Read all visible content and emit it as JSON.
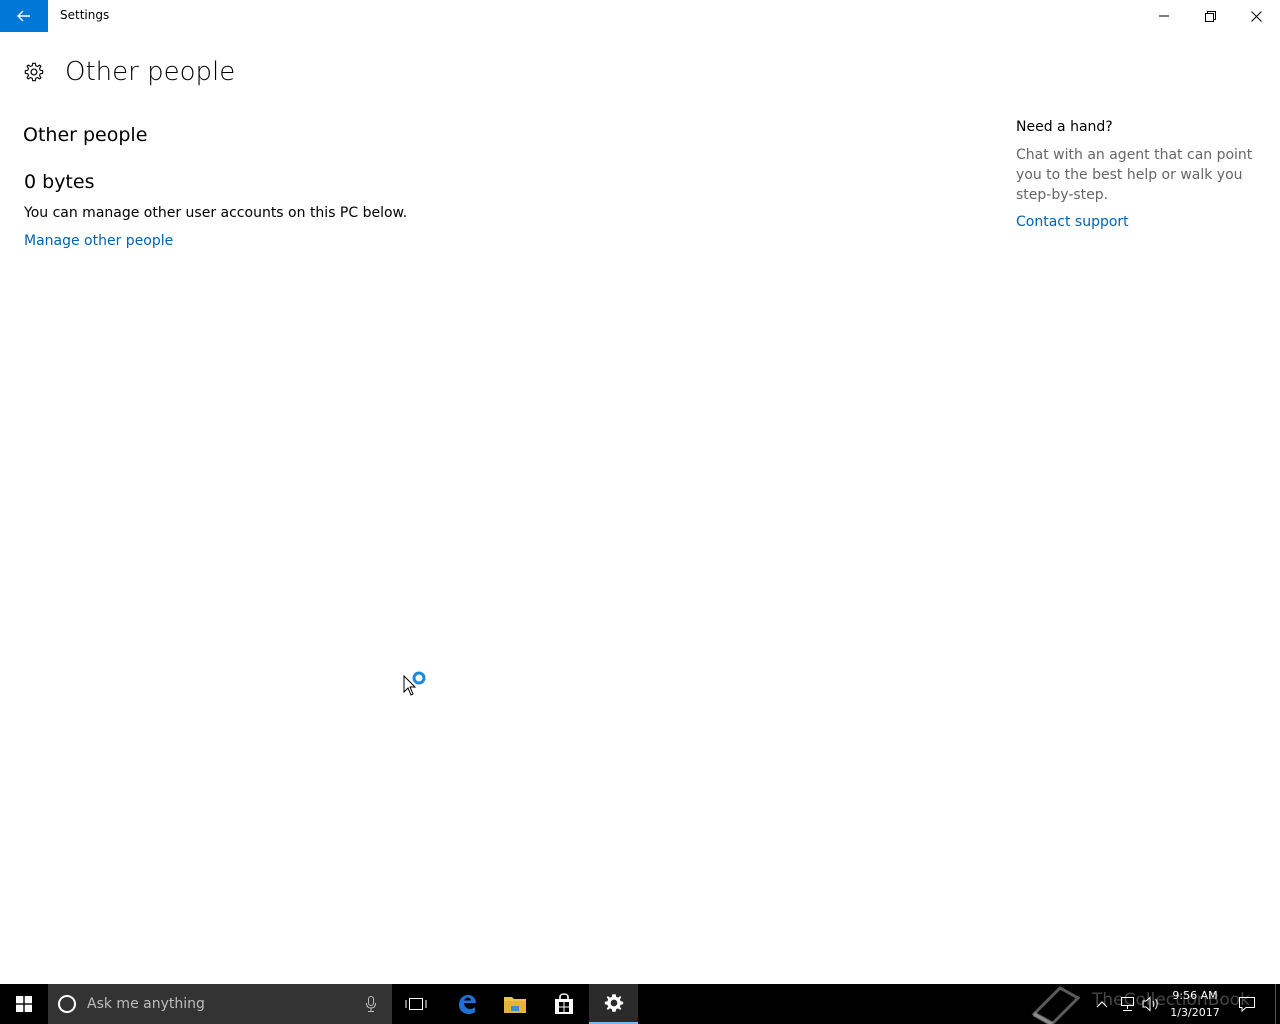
{
  "window": {
    "title": "Settings"
  },
  "page": {
    "title": "Other people"
  },
  "main": {
    "section_title": "Other people",
    "size": "0 bytes",
    "description": "You can manage other user accounts on this PC below.",
    "manage_link": "Manage other people"
  },
  "help": {
    "title": "Need a hand?",
    "text": "Chat with an agent that can point you to the best help or walk you step-by-step.",
    "link": "Contact support"
  },
  "taskbar": {
    "search_placeholder": "Ask me anything",
    "time": "9:56 AM",
    "date": "1/3/2017",
    "watermark": "TheCollectionBook"
  },
  "colors": {
    "accent": "#0078d7",
    "link": "#0063b1",
    "taskbar": "#000000",
    "search_box": "#333333"
  },
  "icons": [
    "back-arrow-icon",
    "minimize-icon",
    "restore-icon",
    "close-icon",
    "gear-icon",
    "busy-cursor-icon",
    "windows-start-icon",
    "cortana-icon",
    "microphone-icon",
    "task-view-icon",
    "edge-icon",
    "file-explorer-icon",
    "store-icon",
    "settings-icon",
    "chevron-up-icon",
    "network-icon",
    "volume-icon",
    "action-center-icon"
  ]
}
